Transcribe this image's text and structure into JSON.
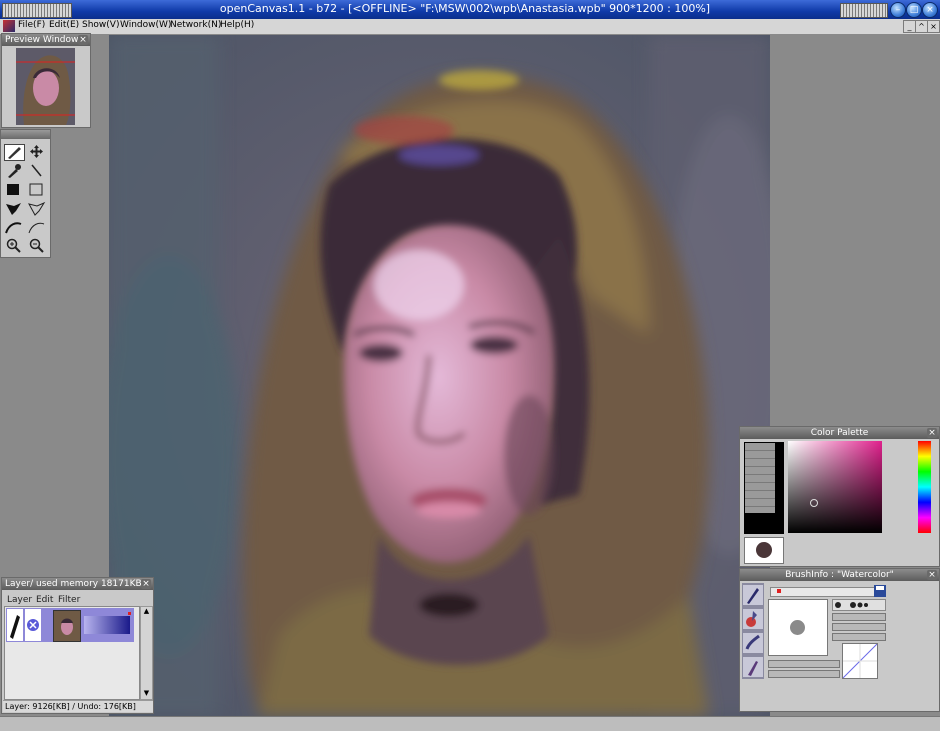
{
  "window": {
    "title": "openCanvas1.1 - b72 - [<OFFLINE> \"F:\\MSW\\002\\wpb\\Anastasia.wpb\" 900*1200 : 100%]"
  },
  "menu": [
    {
      "label": "File(F)"
    },
    {
      "label": "Edit(E)"
    },
    {
      "label": "Show(V)"
    },
    {
      "label": "Window(W)"
    },
    {
      "label": "Network(N)"
    },
    {
      "label": "Help(H)"
    }
  ],
  "preview": {
    "title": "Preview Window"
  },
  "tools": [
    {
      "name": "pen-tool-icon",
      "active": true
    },
    {
      "name": "move-tool-icon"
    },
    {
      "name": "eyedropper-tool-icon"
    },
    {
      "name": "line-tool-icon"
    },
    {
      "name": "fill-rect-tool-icon"
    },
    {
      "name": "rect-select-tool-icon"
    },
    {
      "name": "fill-lasso-tool-icon"
    },
    {
      "name": "lasso-tool-icon"
    },
    {
      "name": "curve-fill-tool-icon"
    },
    {
      "name": "curve-tool-icon"
    },
    {
      "name": "zoom-in-tool-icon"
    },
    {
      "name": "zoom-out-tool-icon"
    }
  ],
  "layer_panel": {
    "title": "Layer/ used memory 18171KB",
    "menu": [
      "Layer",
      "Edit",
      "Filter"
    ],
    "status": "Layer: 9126[KB] / Undo: 176[KB]"
  },
  "color_palette": {
    "title": "Color Palette",
    "current_color": "#4a3638",
    "hue_colors": [
      "#ff0000",
      "#ffff00",
      "#00ff00",
      "#00ffff",
      "#0000ff",
      "#ff00ff",
      "#ff0000"
    ]
  },
  "brush_info": {
    "title": "BrushInfo : \"Watercolor\""
  },
  "colors": {
    "titlebar_blue": "#0f3aa8",
    "panel_gray": "#c9c9c9",
    "layer_selected": "#8e88d8"
  }
}
